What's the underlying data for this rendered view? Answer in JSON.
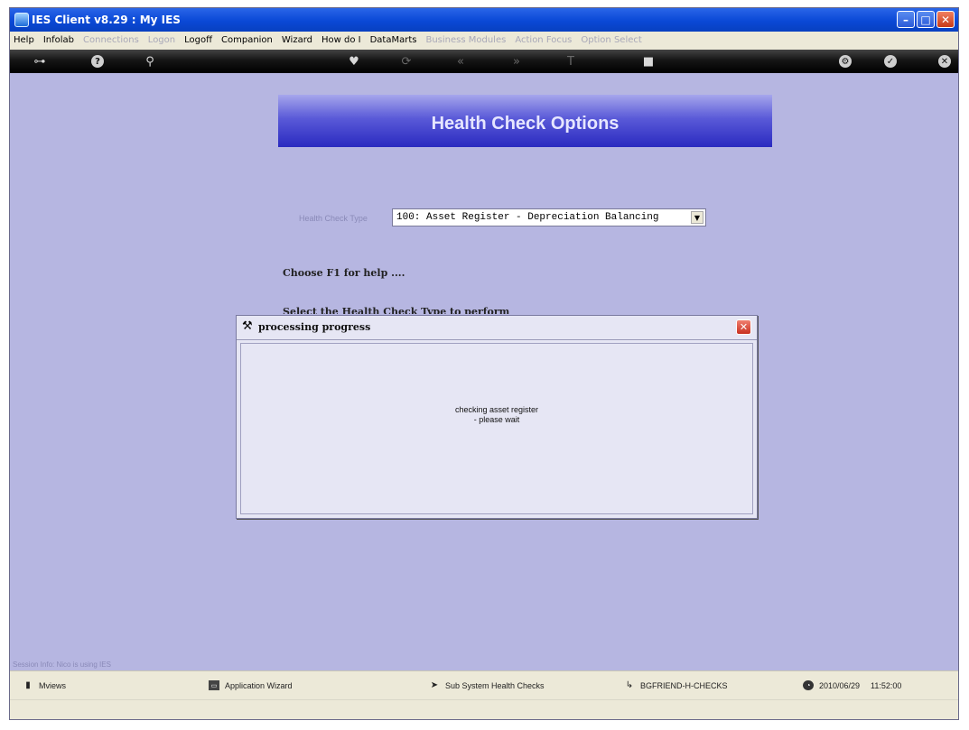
{
  "window": {
    "title": "IES Client v8.29 : My IES"
  },
  "menu": [
    {
      "label": "Help",
      "enabled": true
    },
    {
      "label": "Infolab",
      "enabled": true
    },
    {
      "label": "Connections",
      "enabled": false
    },
    {
      "label": "Logon",
      "enabled": false
    },
    {
      "label": "Logoff",
      "enabled": true
    },
    {
      "label": "Companion",
      "enabled": true
    },
    {
      "label": "Wizard",
      "enabled": true
    },
    {
      "label": "How do I",
      "enabled": true
    },
    {
      "label": "DataMarts",
      "enabled": true
    },
    {
      "label": "Business Modules",
      "enabled": false
    },
    {
      "label": "Action Focus",
      "enabled": false
    },
    {
      "label": "Option Select",
      "enabled": false
    }
  ],
  "page": {
    "title": "Health Check Options"
  },
  "form": {
    "health_check_type_label": "Health Check Type",
    "health_check_type_value": "100: Asset Register - Depreciation Balancing"
  },
  "help": {
    "line1": "Choose F1 for help ....",
    "line2": "Select the Health Check Type to perform"
  },
  "dialog": {
    "title": "processing progress",
    "message_line1": "checking asset register",
    "message_line2": "- please wait"
  },
  "session": {
    "text": "Session Info: Nico is using IES"
  },
  "status": {
    "mviews": "Mviews",
    "wizard": "Application Wizard",
    "subsystem": "Sub System Health Checks",
    "module": "BGFRIEND-H-CHECKS",
    "date": "2010/06/29",
    "time": "11:52:00"
  },
  "icons": {
    "toolbar": [
      "key-icon",
      "help-icon",
      "search-icon",
      "heart-icon",
      "refresh-icon",
      "back-icon",
      "forward-icon",
      "text-icon",
      "stop-icon",
      "settings-icon",
      "check-icon",
      "close-icon"
    ],
    "status": [
      "mviews-icon",
      "wizard-icon",
      "subsystem-icon",
      "module-icon",
      "clock-icon"
    ]
  }
}
